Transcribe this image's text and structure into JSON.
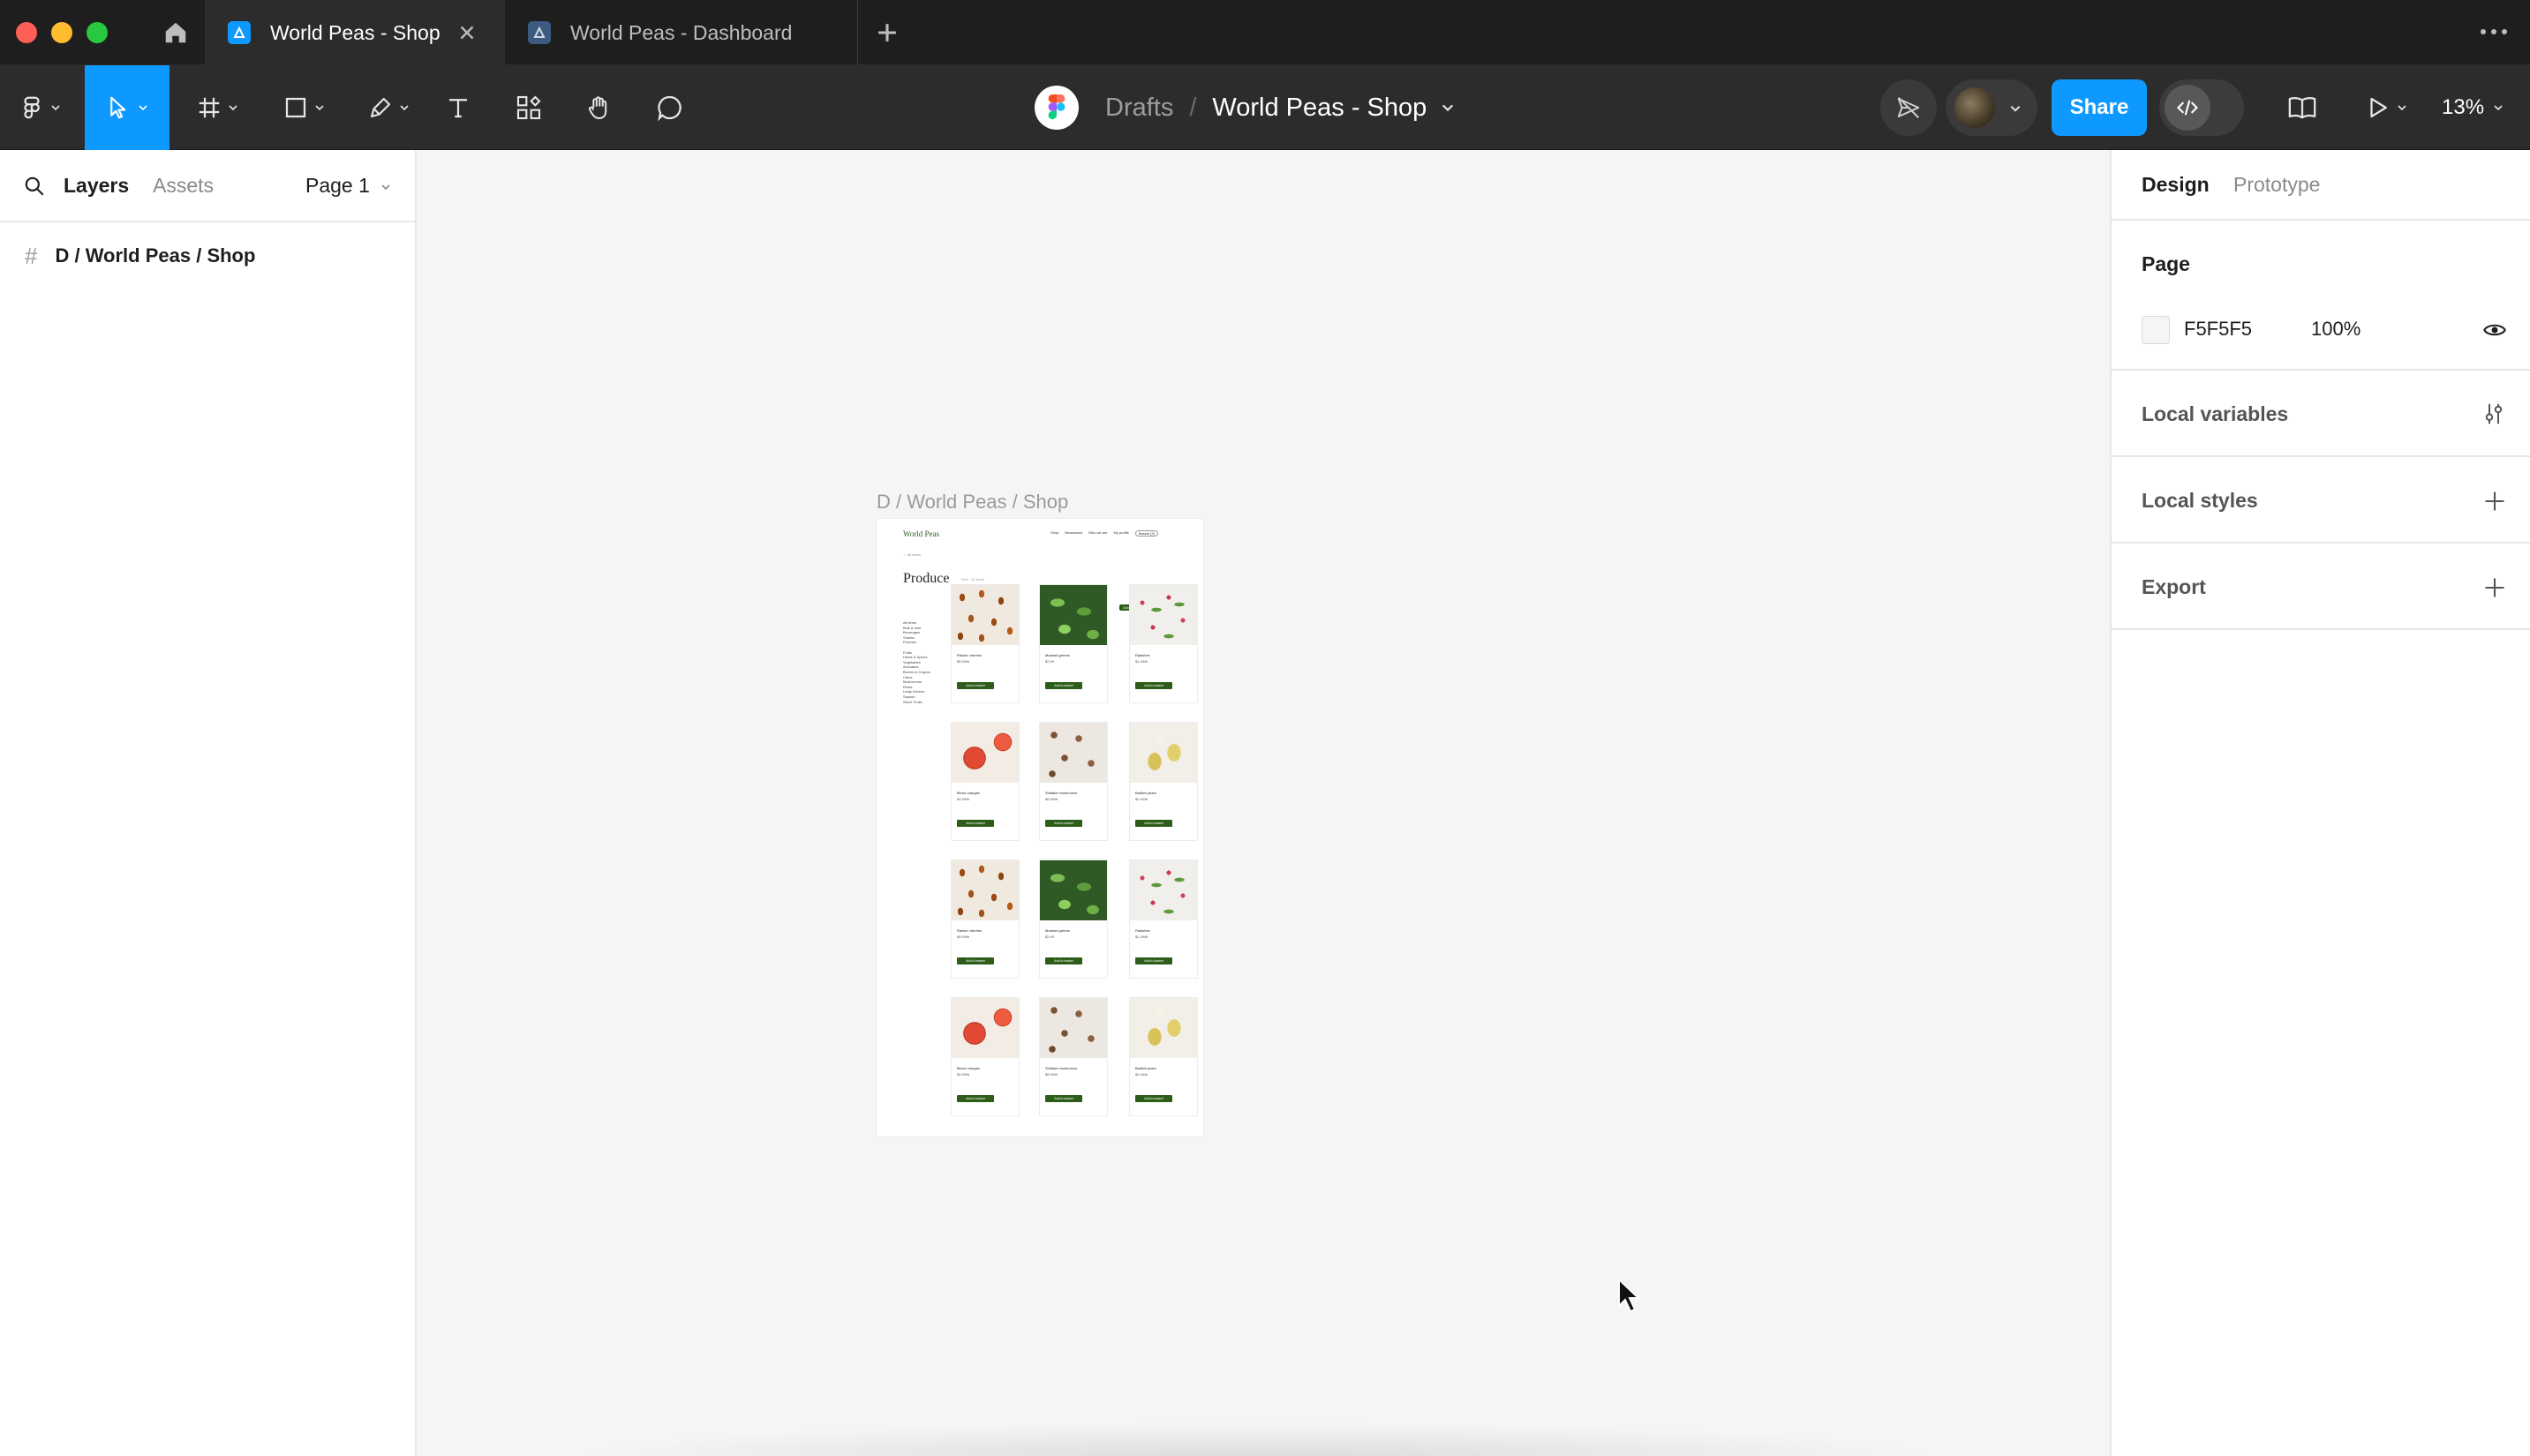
{
  "window": {
    "tabs": [
      {
        "label": "World Peas - Shop",
        "active": true
      },
      {
        "label": "World Peas - Dashboard",
        "active": false
      }
    ],
    "new_tab_icon": "plus-icon",
    "home_icon": "home-icon"
  },
  "toolbar": {
    "breadcrumb": {
      "folder": "Drafts",
      "separator": "/",
      "file": "World Peas - Shop"
    },
    "share_label": "Share",
    "zoom": "13%"
  },
  "left_panel": {
    "tabs": {
      "layers": "Layers",
      "assets": "Assets"
    },
    "page_select": "Page 1",
    "layers": [
      {
        "name": "D / World Peas / Shop",
        "type": "frame"
      }
    ]
  },
  "right_panel": {
    "tabs": {
      "design": "Design",
      "prototype": "Prototype"
    },
    "page": {
      "title": "Page",
      "color_hex": "F5F5F5",
      "opacity": "100%"
    },
    "sections": {
      "local_variables": "Local variables",
      "local_styles": "Local styles",
      "export": "Export"
    }
  },
  "canvas": {
    "background": "#f5f5f5",
    "frame_label": "D / World Peas / Shop",
    "frame": {
      "brand": "World Peas",
      "nav": [
        "Shop",
        "Newsstand",
        "Who we are",
        "My profile"
      ],
      "nav_button": "Basket (3)",
      "breadcrumb": "← All items",
      "heading": "Produce",
      "count": "Sort · 42 items",
      "view_toggle": [
        "Grid",
        "List",
        "Filter"
      ],
      "sidebar": [
        "All items",
        "Bulk & nuts",
        "Beverages",
        "Snacks",
        "Produce",
        "",
        "Fruits",
        "Herbs & Spices",
        "Vegetables",
        "Avocados",
        "Berries & Grapes",
        "Citrus",
        "Mushrooms",
        "Roots",
        "Leafy Greens",
        "Squash",
        "Stone Fruits"
      ],
      "products": [
        {
          "name": "Rainier cherries",
          "price": "$5.99/lb",
          "image": "almond",
          "cta": "Add to basket"
        },
        {
          "name": "Mustard greens",
          "price": "$2.99",
          "image": "herb",
          "cta": "Add to basket"
        },
        {
          "name": "Radishes",
          "price": "$1.49/lb",
          "image": "radish",
          "cta": "Add to basket"
        },
        {
          "name": "Blood oranges",
          "price": "$4.99/lb",
          "image": "melon",
          "cta": "Add to basket"
        },
        {
          "name": "Shiitake mushrooms",
          "price": "$6.99/lb",
          "image": "shroom",
          "cta": "Add to basket"
        },
        {
          "name": "Bartlett pears",
          "price": "$2.49/lb",
          "image": "pear",
          "cta": "Add to basket"
        },
        {
          "name": "Rainier cherries",
          "price": "$5.99/lb",
          "image": "almond",
          "cta": "Add to basket"
        },
        {
          "name": "Mustard greens",
          "price": "$2.99",
          "image": "herb",
          "cta": "Add to basket"
        },
        {
          "name": "Radishes",
          "price": "$1.49/lb",
          "image": "radish",
          "cta": "Add to basket"
        },
        {
          "name": "Blood oranges",
          "price": "$4.99/lb",
          "image": "melon",
          "cta": "Add to basket"
        },
        {
          "name": "Shiitake mushrooms",
          "price": "$6.99/lb",
          "image": "shroom",
          "cta": "Add to basket"
        },
        {
          "name": "Bartlett pears",
          "price": "$2.49/lb",
          "image": "pear",
          "cta": "Add to basket"
        }
      ]
    }
  },
  "colors": {
    "accent": "#0d99ff",
    "toolbar_bg": "#2c2c2c",
    "titlebar_bg": "#1e1e1e",
    "brand_green": "#2c5e1a"
  }
}
